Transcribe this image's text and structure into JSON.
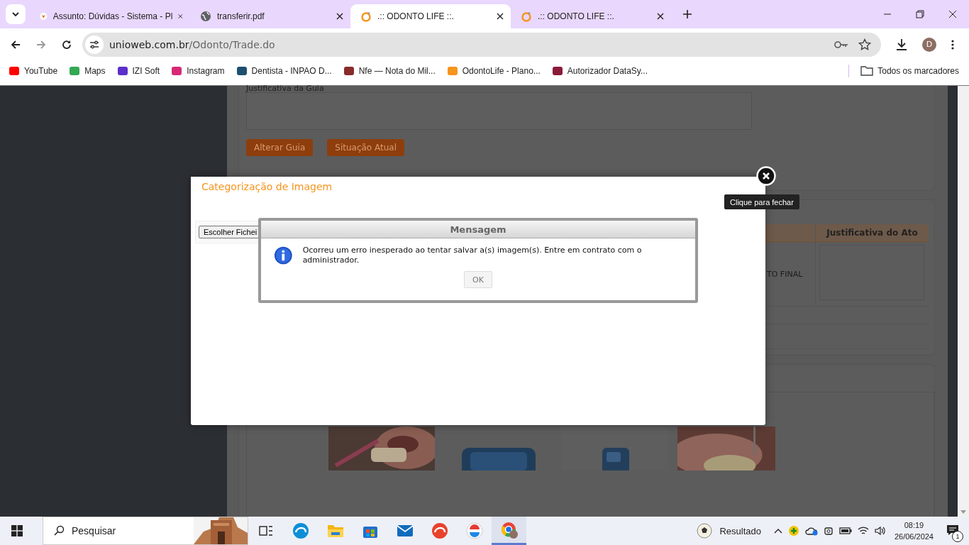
{
  "browser": {
    "tabs": [
      {
        "title": "Assunto: Dúvidas - Sistema - Pl",
        "kind": "shield",
        "selected": false
      },
      {
        "title": "transferir.pdf",
        "kind": "globe",
        "selected": false
      },
      {
        "title": ".:: ODONTO LIFE ::.",
        "kind": "ring",
        "selected": true
      },
      {
        "title": ".:: ODONTO LIFE ::.",
        "kind": "ring",
        "selected": false
      }
    ],
    "address": {
      "host": "unioweb.com.br",
      "path": "/Odonto/Trade.do"
    },
    "profile_initial": "D",
    "bookmarks": [
      {
        "label": "YouTube",
        "color": "#ff0000"
      },
      {
        "label": "Maps",
        "color": "#34a853"
      },
      {
        "label": "IZI Soft",
        "color": "#5b2fc9"
      },
      {
        "label": "Instagram",
        "color": "#d62976"
      },
      {
        "label": "Dentista - INPAO D...",
        "color": "#1d4f6e"
      },
      {
        "label": "Nfe — Nota do Mil...",
        "color": "#8a2b2b"
      },
      {
        "label": "OdontoLife - Plano...",
        "color": "#f7941d"
      },
      {
        "label": "Autorizador DataSy...",
        "color": "#8b1a3a"
      }
    ],
    "all_bookmarks": "Todos os marcadores"
  },
  "page": {
    "guide_justification_label": "Justificativa da Guia",
    "buttons": [
      "Alterar Guia",
      "Situação Atual"
    ],
    "table": {
      "column_header": "Justificativa do Ato",
      "cell": "TO FINAL"
    }
  },
  "modal": {
    "title": "Categorização de Imagem",
    "file_button": "Escolher Fichei",
    "close_tooltip": "Clique para fechar"
  },
  "message": {
    "title": "Mensagem",
    "text": "Ocorreu um erro inesperado ao tentar salvar a(s) imagem(s). Entre em contrato com o administrador.",
    "button": "OK"
  },
  "taskbar": {
    "search_placeholder": "Pesquisar",
    "apps": [
      {
        "kind": "taskview",
        "selected": false
      },
      {
        "kind": "edge",
        "selected": false
      },
      {
        "kind": "files",
        "selected": false
      },
      {
        "kind": "store",
        "selected": false
      },
      {
        "kind": "mail",
        "selected": false
      },
      {
        "kind": "office",
        "selected": false
      },
      {
        "kind": "tv",
        "selected": false
      },
      {
        "kind": "chrome",
        "selected": true
      }
    ],
    "weather": "Resultado",
    "time": "08:19",
    "date": "26/06/2024",
    "notification_count": "1"
  }
}
